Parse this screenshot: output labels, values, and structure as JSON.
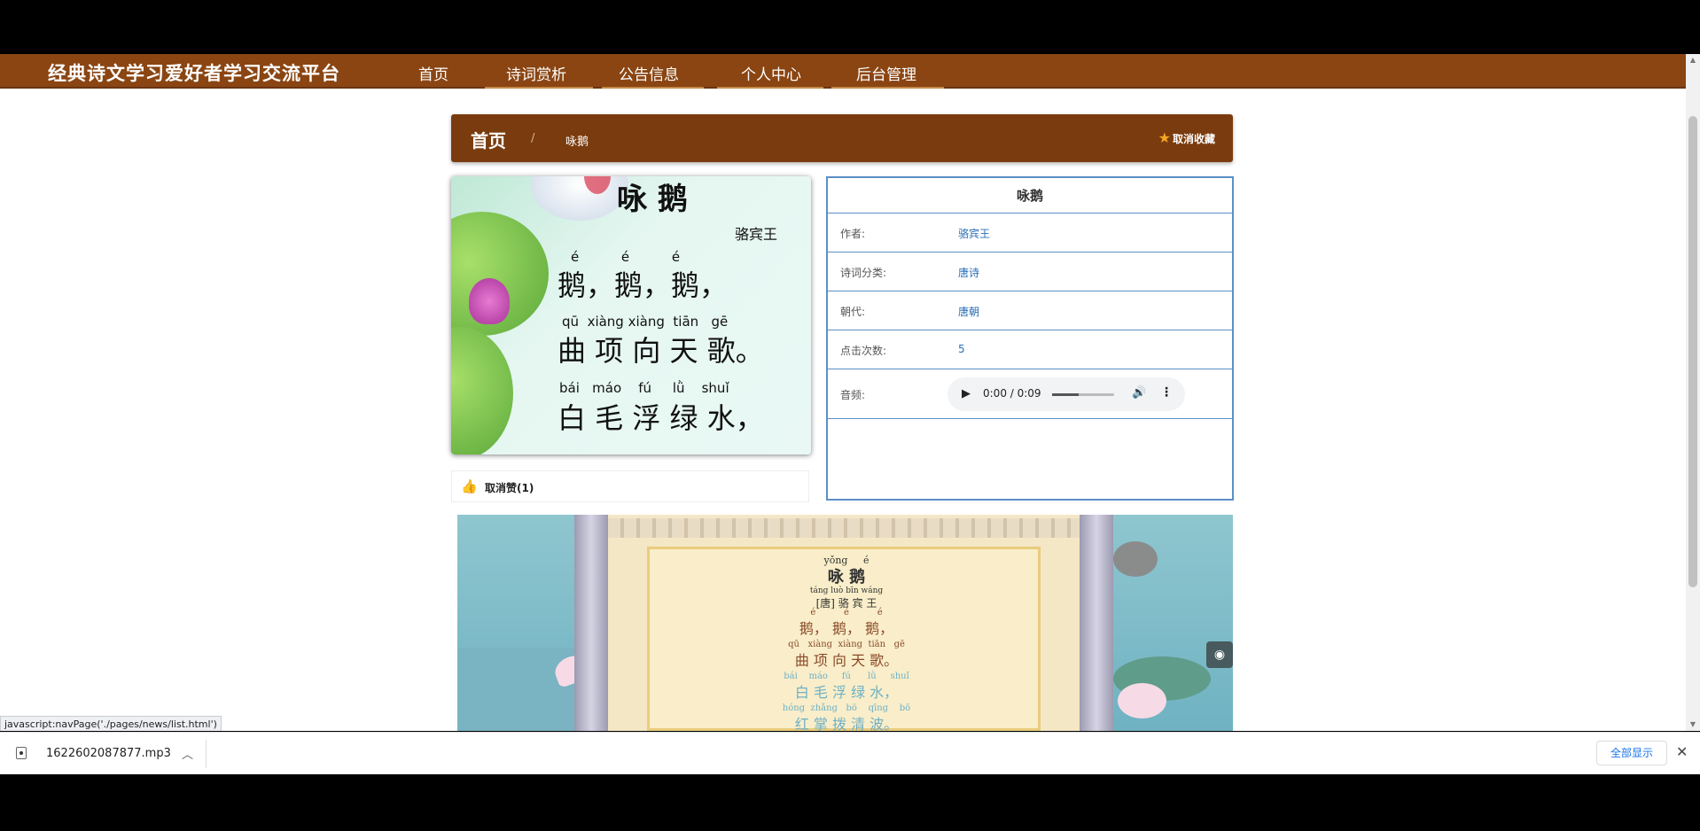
{
  "nav": {
    "site_title": "经典诗文学习爱好者学习交流平台",
    "items": [
      "首页",
      "诗词赏析",
      "公告信息",
      "个人中心",
      "后台管理"
    ]
  },
  "breadcrumb": {
    "home": "首页",
    "separator": "/",
    "current": "咏鹅",
    "unfavorite_label": "取消收藏"
  },
  "poem_image": {
    "title": "咏 鹅",
    "author": "骆宾王",
    "line1_pinyin": "é          é          é",
    "line1": "鹅，鹅，鹅，",
    "line2_pinyin": "qū  xiàng xiàng  tiān   gē",
    "line2": "曲 项 向 天 歌。",
    "line3_pinyin": "bái   máo    fú     lǜ    shuǐ",
    "line3": "白 毛 浮 绿 水，"
  },
  "info": {
    "title": "咏鹅",
    "rows": [
      {
        "label": "作者:",
        "value": "骆宾王"
      },
      {
        "label": "诗词分类:",
        "value": "唐诗"
      },
      {
        "label": "朝代:",
        "value": "唐朝"
      },
      {
        "label": "点击次数:",
        "value": "5"
      }
    ],
    "audio_label": "音频:",
    "audio_time": "0:00 / 0:09"
  },
  "like": {
    "label": "取消赞(1)"
  },
  "video": {
    "title_pinyin": "yǒng     é",
    "title": "咏   鹅",
    "author_pinyin": "táng   luò bīn wáng",
    "author": "[唐] 骆 宾 王",
    "l1_pinyin": "é          é          é",
    "l1": "鹅， 鹅， 鹅，",
    "l2_pinyin": "qū   xiàng  xiàng  tiān   gē",
    "l2": "曲  项  向  天  歌。",
    "l3_pinyin": "bái    máo     fú      lǜ     shuǐ",
    "l3": "白  毛  浮  绿  水，",
    "l4_pinyin": "hóng  zhǎng   bō    qīng    bō",
    "l4": "红  掌  拨  清  波。"
  },
  "status_url": "javascript:navPage('./pages/news/list.html')",
  "download": {
    "file_name": "1622602087877.mp3",
    "show_all": "全部显示"
  },
  "colors": {
    "nav_bg": "#8a4512",
    "breadcrumb_bg": "#7a3c0e",
    "panel_border": "#5b8fc7",
    "link": "#2a6fb6"
  }
}
